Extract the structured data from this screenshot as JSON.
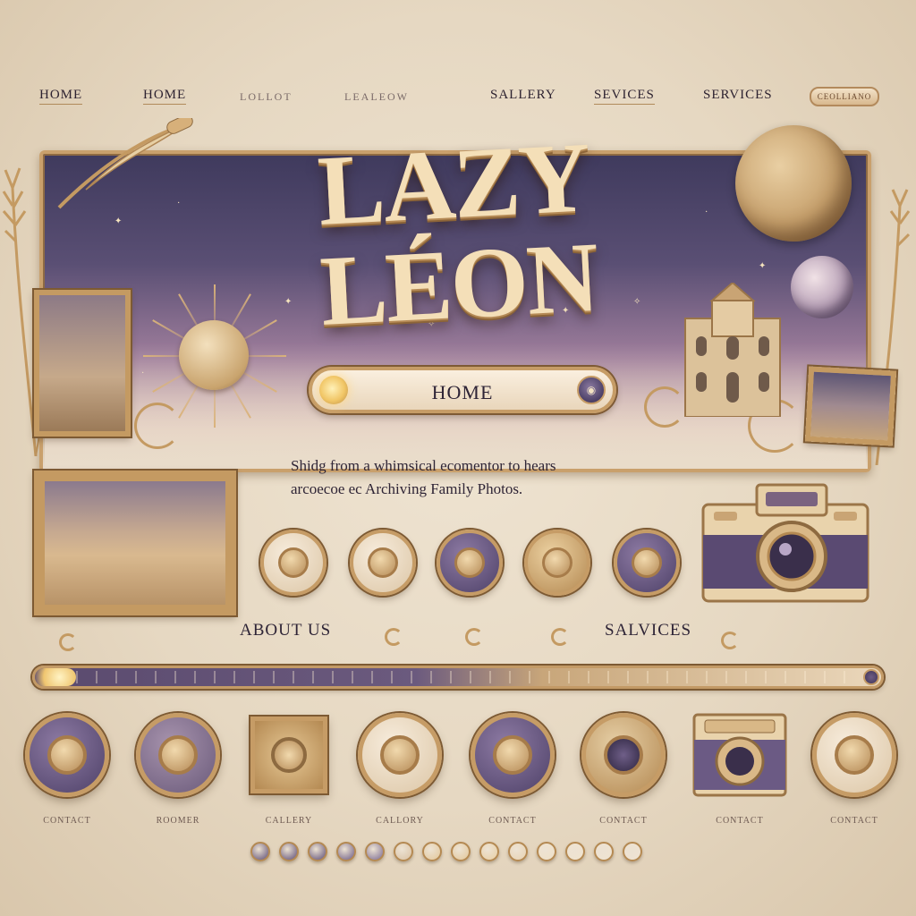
{
  "nav": {
    "items": [
      {
        "label": "HOME",
        "faint": false
      },
      {
        "label": "HOME",
        "faint": false
      },
      {
        "label": "LOLLOT",
        "faint": true
      },
      {
        "label": "LEALEOW",
        "faint": true
      },
      {
        "label": "SALLERY",
        "faint": false
      },
      {
        "label": "SEVICES",
        "faint": false
      },
      {
        "label": "SERVICES",
        "faint": false
      }
    ],
    "pill_label": "CEOLLIANO"
  },
  "hero": {
    "title": "LAZY LÉON",
    "home_button_label": "HOME"
  },
  "tagline": {
    "line1": "Shiԁg from a whimsical ecomentor to hears",
    "line2": "arcoecoe ec Archiving Family Photos."
  },
  "sections": {
    "about_label": "ABOUT US",
    "services_label": "SALVICES"
  },
  "bottom_labels": [
    "CONTACT",
    "ROOMER",
    "CALLERY",
    "CALLORY",
    "CONTACT",
    "CONTACT",
    "CONTACT",
    "CONTACT"
  ],
  "colors": {
    "background": "#e6d8c2",
    "gold": "#c69c66",
    "plum": "#4e4168",
    "cream": "#f3e4cc",
    "text": "#2e2436"
  },
  "dots": [
    "#5b4b75",
    "#5b4b75",
    "#5b4b75",
    "#6b5a84",
    "#7a6a92",
    "#d9c1a3",
    "#e3c79a",
    "#e3c79a",
    "#e8cfa4",
    "#e8d3b2",
    "#efe0c7",
    "#f0e3cf",
    "#efe3d2",
    "#efe3d2"
  ]
}
